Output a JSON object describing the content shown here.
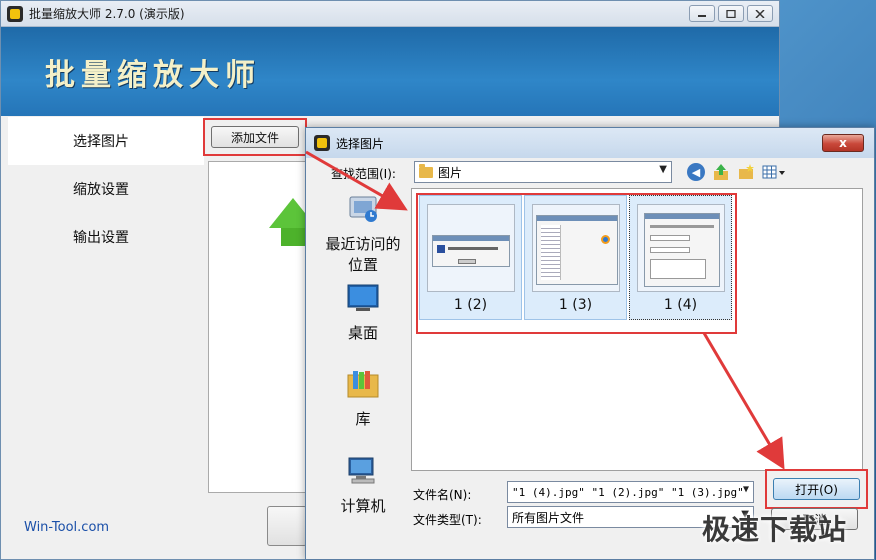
{
  "main_window": {
    "title": "批量缩放大师 2.7.0 (演示版)",
    "banner_title": "批量缩放大师",
    "controls": [
      "minimize-icon",
      "maximize-icon",
      "close-icon"
    ],
    "sidebar": [
      {
        "label": "选择图片",
        "active": true
      },
      {
        "label": "缩放设置",
        "active": false
      },
      {
        "label": "输出设置",
        "active": false
      }
    ],
    "add_file_button": "添加文件",
    "footer_link": "Win-Tool.com"
  },
  "dialog": {
    "title": "选择图片",
    "close_label": "x",
    "look_in_label": "查找范围(I):",
    "look_in_value": "图片",
    "places": [
      {
        "label": "最近访问的位置",
        "icon": "recent-places-icon"
      },
      {
        "label": "桌面",
        "icon": "desktop-icon"
      },
      {
        "label": "库",
        "icon": "libraries-icon"
      },
      {
        "label": "计算机",
        "icon": "computer-icon"
      }
    ],
    "files": [
      {
        "name": "1 (2)",
        "selected": true
      },
      {
        "name": "1 (3)",
        "selected": true
      },
      {
        "name": "1 (4)",
        "selected": true,
        "focused": true
      }
    ],
    "file_name_label": "文件名(N):",
    "file_name_value": "\"1 (4).jpg\" \"1 (2).jpg\" \"1 (3).jpg\"",
    "file_type_label": "文件类型(T):",
    "file_type_value": "所有图片文件",
    "open_button": "打开(O)",
    "cancel_button": "取消"
  },
  "watermark": "极速下载站",
  "colors": {
    "banner": "#2f86c8",
    "highlight": "#e03a3a",
    "selection": "#dcecfb",
    "banner_text": "#f4f0c8"
  }
}
